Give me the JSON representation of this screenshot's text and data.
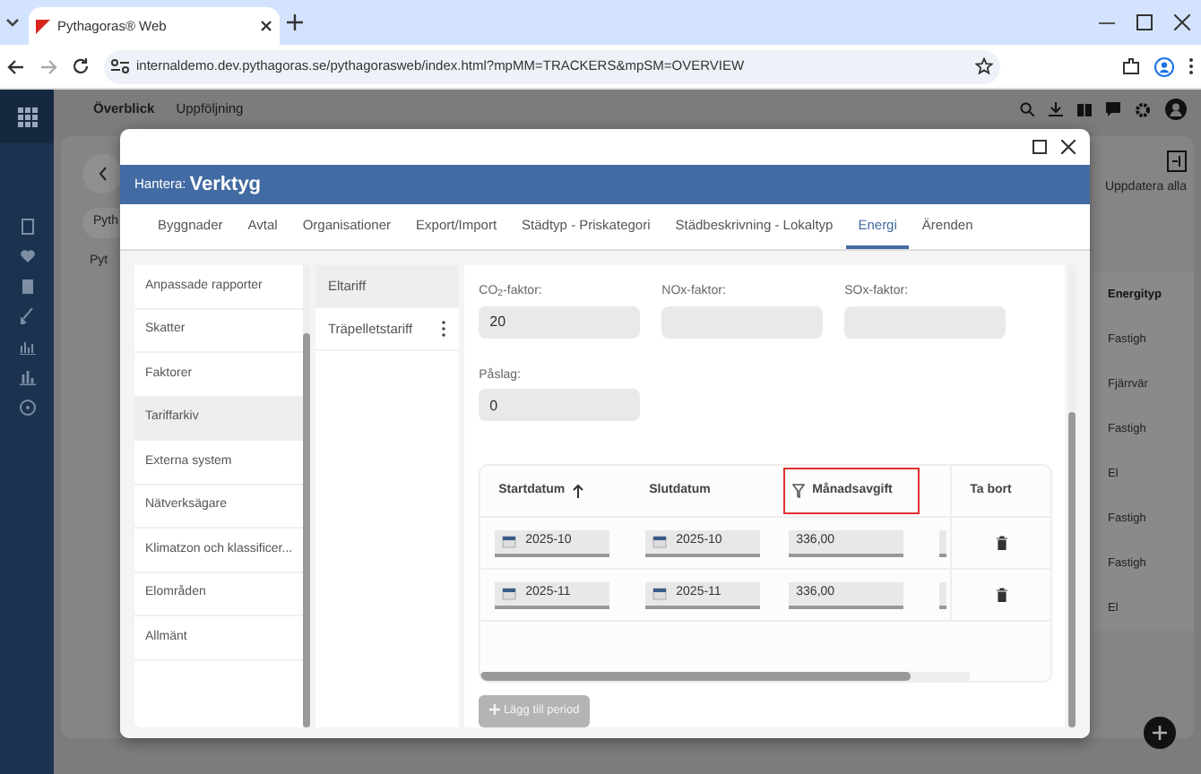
{
  "browser": {
    "tab_title": "Pythagoras® Web",
    "url": "internaldemo.dev.pythagoras.se/pythagorasweb/index.html?mpMM=TRACKERS&mpSM=OVERVIEW"
  },
  "app": {
    "nav_tabs": [
      {
        "label": "Överblick",
        "selected": true
      },
      {
        "label": "Uppföljning",
        "selected": false
      }
    ],
    "update_all": "Uppdatera alla",
    "filter_chip": "Pyth",
    "tree_item": "Pyt",
    "energy_column": {
      "header": "Energityp",
      "cells": [
        "Fastigh",
        "Fjärrvär",
        "Fastigh",
        "El",
        "Fastigh",
        "Fastigh",
        "El"
      ]
    }
  },
  "dialog": {
    "prefix": "Hantera:",
    "title": "Verktyg",
    "tabs": [
      {
        "label": "Byggnader",
        "selected": false
      },
      {
        "label": "Avtal",
        "selected": false
      },
      {
        "label": "Organisationer",
        "selected": false
      },
      {
        "label": "Export/Import",
        "selected": false
      },
      {
        "label": "Städtyp - Priskategori",
        "selected": false
      },
      {
        "label": "Städbeskrivning - Lokaltyp",
        "selected": false
      },
      {
        "label": "Energi",
        "selected": true
      },
      {
        "label": "Ärenden",
        "selected": false
      }
    ],
    "categories": [
      {
        "label": "Anpassade rapporter",
        "selected": false
      },
      {
        "label": "Skatter",
        "selected": false
      },
      {
        "label": "Faktorer",
        "selected": false
      },
      {
        "label": "Tariffarkiv",
        "selected": true
      },
      {
        "label": "Externa system",
        "selected": false
      },
      {
        "label": "Nätverksägare",
        "selected": false
      },
      {
        "label": "Klimatzon och klassificer...",
        "selected": false
      },
      {
        "label": "Elområden",
        "selected": false
      },
      {
        "label": "Allmänt",
        "selected": false
      }
    ],
    "tariffs": [
      {
        "label": "Eltariff",
        "selected": true,
        "menu": false
      },
      {
        "label": "Träpelletstariff",
        "selected": false,
        "menu": true
      }
    ],
    "fields": [
      {
        "label": "CO$_{2}$-faktor:",
        "value": "20"
      },
      {
        "label": "NOx-faktor:"
      },
      {
        "label": "SOx-faktor:"
      },
      {
        "label": "Påslag:",
        "value": "0"
      }
    ],
    "periods": {
      "columns": [
        {
          "label": "Startdatum",
          "sorted_ascending": true,
          "filter": false,
          "highlighted": false
        },
        {
          "label": "Slutdatum",
          "sorted_ascending": false,
          "filter": false,
          "highlighted": false
        },
        {
          "label": "Månadsavgift",
          "sorted_ascending": false,
          "filter": true,
          "highlighted": true
        },
        {
          "label": "Ta bort",
          "sorted_ascending": false,
          "filter": false,
          "highlighted": false
        }
      ],
      "rows": [
        {
          "start": "2025-10",
          "end": "2025-10",
          "fee": "336,00"
        },
        {
          "start": "2025-11",
          "end": "2025-11",
          "fee": "336,00"
        }
      ]
    },
    "add_button": {
      "label": "Lägg till period",
      "disabled": true
    }
  }
}
